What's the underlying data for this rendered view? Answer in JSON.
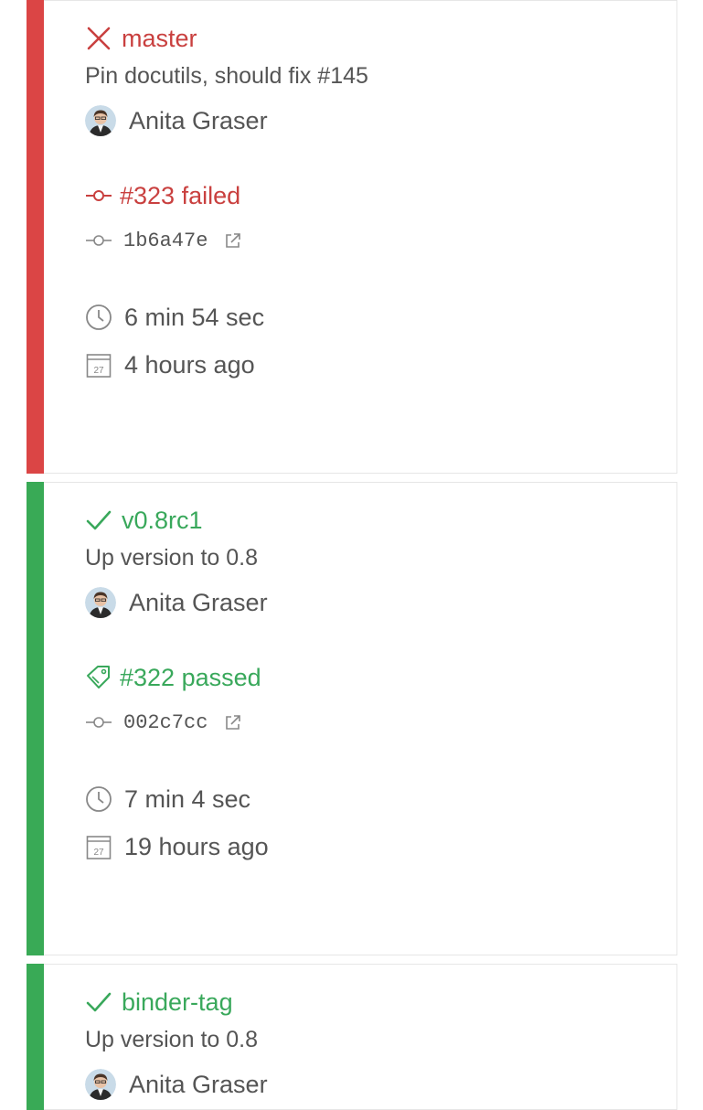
{
  "colors": {
    "failed": "#db4545",
    "failed_text": "#c9403f",
    "passed": "#39aa56",
    "passed_text": "#39a85b"
  },
  "builds": [
    {
      "status": "failed",
      "branch": "master",
      "message": "Pin docutils, should fix #145",
      "author": "Anita Graser",
      "build_label": "#323 failed",
      "build_icon": "commit-icon",
      "commit": "1b6a47e",
      "duration": "6 min 54 sec",
      "finished": "4 hours ago",
      "calendar_day": "27"
    },
    {
      "status": "passed",
      "branch": "v0.8rc1",
      "message": "Up version to 0.8",
      "author": "Anita Graser",
      "build_label": "#322 passed",
      "build_icon": "tag-icon",
      "commit": "002c7cc",
      "duration": "7 min 4 sec",
      "finished": "19 hours ago",
      "calendar_day": "27"
    },
    {
      "status": "passed",
      "branch": "binder-tag",
      "message": "Up version to 0.8",
      "author": "Anita Graser"
    }
  ]
}
